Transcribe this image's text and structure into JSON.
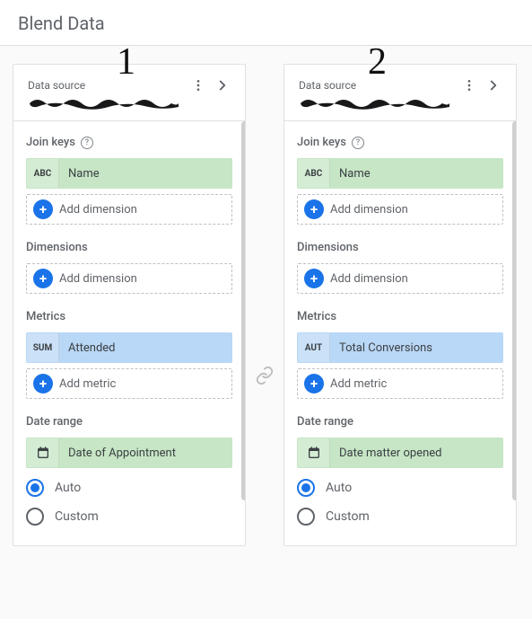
{
  "header": {
    "title": "Blend Data"
  },
  "annotations": {
    "one": "1",
    "two": "2"
  },
  "join_keys_label": "Join keys",
  "dimensions_label": "Dimensions",
  "metrics_label": "Metrics",
  "date_range_label": "Date range",
  "add_dimension_label": "Add dimension",
  "add_metric_label": "Add metric",
  "auto_label": "Auto",
  "custom_label": "Custom",
  "sources": [
    {
      "label": "Data source",
      "join_key": {
        "type": "ABC",
        "name": "Name"
      },
      "metric": {
        "type": "SUM",
        "name": "Attended"
      },
      "date_chip": {
        "name": "Date of Appointment"
      },
      "range_mode": "auto"
    },
    {
      "label": "Data source",
      "join_key": {
        "type": "ABC",
        "name": "Name"
      },
      "metric": {
        "type": "AUT",
        "name": "Total Conversions"
      },
      "date_chip": {
        "name": "Date matter opened"
      },
      "range_mode": "auto"
    }
  ]
}
